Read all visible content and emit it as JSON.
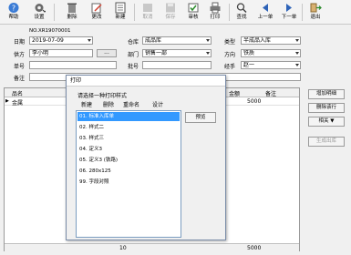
{
  "toolbar": {
    "help": "帮助",
    "settings": "设置",
    "delete": "删除",
    "modify": "更改",
    "new": "新建",
    "cancel": "取消",
    "save": "保存",
    "audit": "审核",
    "print": "打印",
    "find": "查找",
    "prev": "上一单",
    "next": "下一单",
    "exit": "退出"
  },
  "doc_no": "NO.XR19070001",
  "form": {
    "date_label": "日期",
    "date_value": "2019-07-09",
    "warehouse_label": "仓库",
    "warehouse_value": "成品库",
    "type_label": "类型",
    "type_value": "半成品入库",
    "supplier_label": "供方",
    "supplier_value": "李小明",
    "supplier_btn": "...",
    "dept_label": "部门",
    "dept_value": "销售一部",
    "direction_label": "方向",
    "direction_value": "铁质",
    "doc_label": "单号",
    "doc_value": "",
    "batch_label": "批号",
    "batch_value": "",
    "handler_label": "经手",
    "handler_value": "赵一",
    "remark_label": "备注",
    "remark_value": ""
  },
  "grid": {
    "col_name": "品名",
    "col_amount": "金额",
    "col_remark": "备注",
    "row_marker": "▶",
    "row_name": "金属",
    "row_amount": "5000",
    "footer_qty": "10",
    "footer_amount": "5000"
  },
  "side_buttons": {
    "add_row": "增加明细",
    "del_row": "删除该行",
    "reference": "相关 ▼",
    "generate": "生成出库"
  },
  "dialog": {
    "title": "打印",
    "prompt": "请选择一种打印样式",
    "menu": [
      "新建",
      "删除",
      "重命名",
      "设计"
    ],
    "items": [
      "01. 标准入库单",
      "02. 样式二",
      "03. 样式三",
      "04. 定义3",
      "05. 定义3 (铁路)",
      "06. 280x125",
      "99. 字段对照"
    ],
    "selected_index": 0,
    "print_btn": "预览"
  },
  "colors": {
    "selection": "#3399ff",
    "toolbar_bg": "#f3f3f3"
  }
}
